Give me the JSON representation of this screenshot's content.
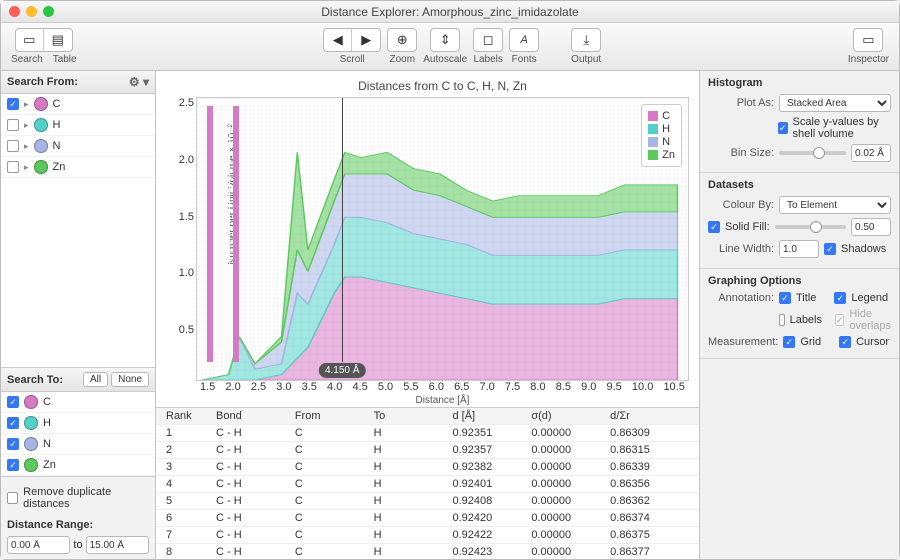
{
  "window": {
    "title": "Distance Explorer: Amorphous_zinc_imidazolate"
  },
  "toolbar": {
    "search": "Search",
    "table": "Table",
    "scroll": "Scroll",
    "zoom": "Zoom",
    "autoscale": "Autoscale",
    "labels": "Labels",
    "fonts": "Fonts",
    "output": "Output",
    "inspector": "Inspector"
  },
  "left": {
    "search_from": "Search From:",
    "search_to": "Search To:",
    "all": "All",
    "none": "None",
    "remove_dup": "Remove duplicate distances",
    "range_label": "Distance Range:",
    "range_from": "0.00 Å",
    "range_to": "15.00 Å",
    "to": "to",
    "elements": [
      {
        "sym": "C",
        "color": "#d67ac3",
        "from_checked": true,
        "to_checked": true
      },
      {
        "sym": "H",
        "color": "#53d1c9",
        "from_checked": false,
        "to_checked": true
      },
      {
        "sym": "N",
        "color": "#a6b5e3",
        "from_checked": false,
        "to_checked": true
      },
      {
        "sym": "Zn",
        "color": "#5bc95b",
        "from_checked": false,
        "to_checked": true
      }
    ]
  },
  "chart": {
    "title": "Distances from C to C, H, N, Zn",
    "xlabel": "Distance [Å]",
    "ylabel": "Number per Unit Volume × 10⁻²",
    "cursor": "4.150 Å",
    "legend": [
      "C",
      "H",
      "N",
      "Zn"
    ],
    "legend_colors": [
      "#d67ac3",
      "#53d1c9",
      "#a6b5e3",
      "#5bc95b"
    ],
    "yticks": [
      "2.5",
      "2.0",
      "1.5",
      "1.0",
      "0.5",
      ""
    ],
    "xticks": [
      "1.5",
      "2.0",
      "2.5",
      "3.0",
      "3.5",
      "4.0",
      "4.5",
      "5.0",
      "5.5",
      "6.0",
      "6.5",
      "7.0",
      "7.5",
      "8.0",
      "8.5",
      "9.0",
      "9.5",
      "10.0",
      "10.5"
    ]
  },
  "chart_data": {
    "type": "area",
    "title": "Distances from C to C, H, N, Zn",
    "xlabel": "Distance [Å]",
    "ylabel": "Number per Unit Volume × 10⁻²",
    "xlim": [
      1.4,
      10.7
    ],
    "ylim": [
      0,
      2.6
    ],
    "stacked": true,
    "x": [
      1.5,
      2.0,
      2.2,
      2.5,
      3.0,
      3.3,
      3.5,
      4.0,
      4.2,
      4.5,
      5.0,
      5.5,
      6.0,
      6.5,
      7.0,
      7.5,
      8.0,
      8.5,
      9.0,
      9.5,
      10.0,
      10.5
    ],
    "series": [
      {
        "name": "C",
        "color": "#d67ac3",
        "values": [
          0.0,
          0.0,
          0.0,
          0.0,
          0.05,
          0.2,
          0.3,
          0.8,
          0.95,
          0.95,
          0.9,
          0.85,
          0.8,
          0.75,
          0.7,
          0.7,
          0.7,
          0.7,
          0.7,
          0.75,
          0.75,
          0.75
        ]
      },
      {
        "name": "H",
        "color": "#53d1c9",
        "values": [
          0.0,
          0.05,
          0.4,
          0.1,
          0.1,
          0.6,
          0.4,
          0.45,
          0.55,
          0.55,
          0.55,
          0.5,
          0.5,
          0.5,
          0.45,
          0.45,
          0.45,
          0.45,
          0.45,
          0.45,
          0.45,
          0.45
        ]
      },
      {
        "name": "N",
        "color": "#a6b5e3",
        "values": [
          0.0,
          0.0,
          0.0,
          0.05,
          0.2,
          0.4,
          0.3,
          0.4,
          0.4,
          0.4,
          0.45,
          0.4,
          0.4,
          0.35,
          0.35,
          0.35,
          0.35,
          0.35,
          0.35,
          0.35,
          0.35,
          0.35
        ]
      },
      {
        "name": "Zn",
        "color": "#5bc95b",
        "values": [
          0.0,
          0.0,
          0.0,
          0.0,
          0.05,
          0.9,
          0.2,
          0.2,
          0.2,
          0.15,
          0.2,
          0.2,
          0.2,
          0.15,
          0.15,
          0.2,
          0.2,
          0.2,
          0.2,
          0.25,
          0.25,
          0.25
        ]
      }
    ],
    "vertical_bars_x": [
      1.58,
      1.62,
      2.08,
      2.12
    ]
  },
  "table": {
    "headers": [
      "Rank",
      "Bond",
      "From",
      "To",
      "d [Å]",
      "σ(d)",
      "d/Σr"
    ],
    "rows": [
      [
        "1",
        "C - H",
        "C",
        "H",
        "0.92351",
        "0.00000",
        "0.86309"
      ],
      [
        "2",
        "C - H",
        "C",
        "H",
        "0.92357",
        "0.00000",
        "0.86315"
      ],
      [
        "3",
        "C - H",
        "C",
        "H",
        "0.92382",
        "0.00000",
        "0.86339"
      ],
      [
        "4",
        "C - H",
        "C",
        "H",
        "0.92401",
        "0.00000",
        "0.86356"
      ],
      [
        "5",
        "C - H",
        "C",
        "H",
        "0.92408",
        "0.00000",
        "0.86362"
      ],
      [
        "6",
        "C - H",
        "C",
        "H",
        "0.92420",
        "0.00000",
        "0.86374"
      ],
      [
        "7",
        "C - H",
        "C",
        "H",
        "0.92422",
        "0.00000",
        "0.86375"
      ],
      [
        "8",
        "C - H",
        "C",
        "H",
        "0.92423",
        "0.00000",
        "0.86377"
      ]
    ]
  },
  "inspector": {
    "histogram": "Histogram",
    "plot_as_lbl": "Plot As:",
    "plot_as": "Stacked Area",
    "scale_shell": "Scale y-values by shell volume",
    "bin_size_lbl": "Bin Size:",
    "bin_size": "0.02 Å",
    "datasets": "Datasets",
    "colour_by_lbl": "Colour By:",
    "colour_by": "To Element",
    "solid_fill": "Solid Fill:",
    "solid_fill_val": "0.50",
    "line_width_lbl": "Line Width:",
    "line_width": "1.0",
    "shadows": "Shadows",
    "graphing": "Graphing Options",
    "annotation": "Annotation:",
    "title_cb": "Title",
    "legend_cb": "Legend",
    "labels_cb": "Labels",
    "hide_overlaps": "Hide overlaps",
    "measurement": "Measurement:",
    "grid": "Grid",
    "cursor": "Cursor"
  }
}
